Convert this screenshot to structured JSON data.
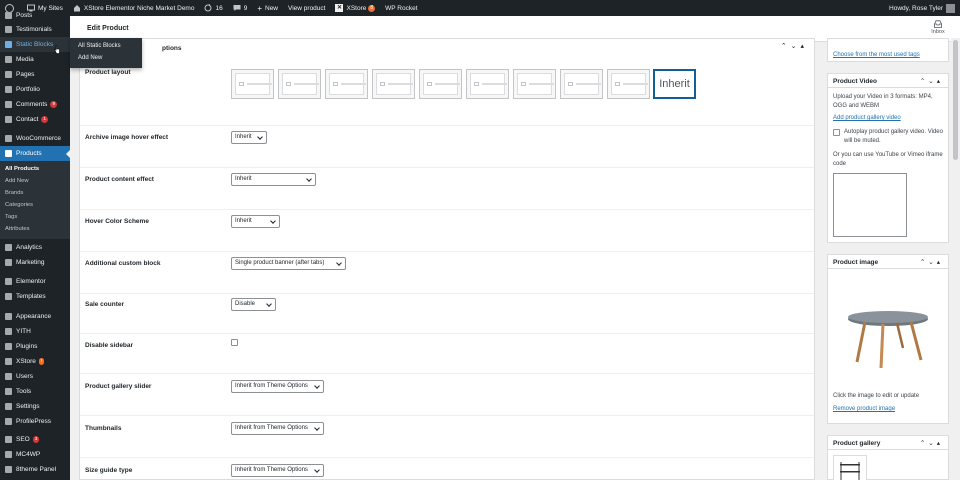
{
  "adminbar": {
    "my_sites": "My Sites",
    "site_name": "XStore Elementor Niche Market Demo",
    "updates_count": "16",
    "comments_count": "9",
    "new_label": "New",
    "view_product": "View product",
    "xstore_label": "XStore",
    "xstore_badge": "8",
    "wp_rocket": "WP Rocket",
    "howdy": "Howdy, Rose Tyler"
  },
  "sidebar": {
    "posts": "Posts",
    "testimonials": "Testimonials",
    "static_blocks": "Static Blocks",
    "media": "Media",
    "pages": "Pages",
    "portfolio": "Portfolio",
    "comments": "Comments",
    "comments_badge": "9",
    "contact": "Contact",
    "contact_badge": "1",
    "woocommerce": "WooCommerce",
    "products": "Products",
    "sub_all_products": "All Products",
    "sub_add_new": "Add New",
    "sub_brands": "Brands",
    "sub_categories": "Categories",
    "sub_tags": "Tags",
    "sub_attributes": "Attributes",
    "analytics": "Analytics",
    "marketing": "Marketing",
    "elementor": "Elementor",
    "templates": "Templates",
    "appearance": "Appearance",
    "yith": "YITH",
    "plugins": "Plugins",
    "xstore": "XStore",
    "xstore_badge": "!",
    "users": "Users",
    "tools": "Tools",
    "settings": "Settings",
    "profilepress": "ProfilePress",
    "seo": "SEO",
    "seo_badge": "3",
    "mc4wp": "MC4WP",
    "theme_panel": "8theme Panel"
  },
  "flyout": {
    "all_static_blocks": "All Static Blocks",
    "add_new": "Add New"
  },
  "header": {
    "title": "Edit Product",
    "inbox": "Inbox"
  },
  "main": {
    "section_title": "ptions",
    "product_layout_label": "Product layout",
    "inherit_option": "Inherit",
    "fields": {
      "archive_hover": {
        "label": "Archive image hover effect",
        "value": "Inherit"
      },
      "content_effect": {
        "label": "Product content effect",
        "value": "Inherit"
      },
      "hover_scheme": {
        "label": "Hover Color Scheme",
        "value": "Inherit"
      },
      "custom_block": {
        "label": "Additional custom block",
        "value": "Single product banner (after tabs)"
      },
      "sale_counter": {
        "label": "Sale counter",
        "value": "Disable"
      },
      "disable_sidebar": {
        "label": "Disable sidebar"
      },
      "gallery_slider": {
        "label": "Product gallery slider",
        "value": "Inherit from Theme Options"
      },
      "thumbnails": {
        "label": "Thumbnails",
        "value": "Inherit from Theme Options"
      },
      "size_guide": {
        "label": "Size guide type",
        "value": "Inherit from Theme Options"
      }
    }
  },
  "right": {
    "tags_link": "Choose from the most used tags",
    "video": {
      "title": "Product Video",
      "desc_line1": "Upload your Video in 3 formats: MP4,",
      "desc_line2": "OGG and WEBM",
      "add_link": "Add product gallery video",
      "autoplay_line1": "Autoplay product gallery video. Video",
      "autoplay_line2": "will be muted.",
      "iframe_line1": "Or you can use YouTube or Vimeo iframe",
      "iframe_line2": "code"
    },
    "image": {
      "title": "Product image",
      "hint": "Click the image to edit or update",
      "remove_link": "Remove product image"
    },
    "gallery": {
      "title": "Product gallery"
    }
  }
}
